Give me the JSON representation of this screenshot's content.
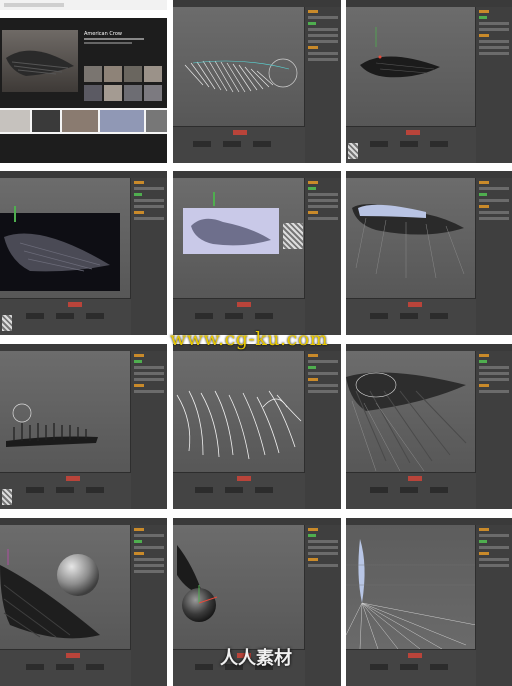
{
  "watermark_text": "www.cg-ku.com",
  "watermark_logo_text": "人人素材",
  "search_result": {
    "title": "American Crow"
  },
  "colors": {
    "viewport": "#5f5f5f",
    "panel": "#3f3f3f",
    "accent_orange": "#c98a2a",
    "accent_red": "#b9443a",
    "watermark": "#e8c800"
  },
  "tiles": [
    {
      "name": "tile-image-search-results"
    },
    {
      "name": "tile-feather-curves"
    },
    {
      "name": "tile-wing-dark-viewport"
    },
    {
      "name": "tile-wing-reference-dark"
    },
    {
      "name": "tile-wing-silhouette-plane"
    },
    {
      "name": "tile-wing-plane-feathers"
    },
    {
      "name": "tile-feather-row-side"
    },
    {
      "name": "tile-curve-strands-closeup"
    },
    {
      "name": "tile-wing-feathers-perspective"
    },
    {
      "name": "tile-wing-with-sphere"
    },
    {
      "name": "tile-sphere-feather-closeup"
    },
    {
      "name": "tile-feather-guides-grid"
    }
  ]
}
